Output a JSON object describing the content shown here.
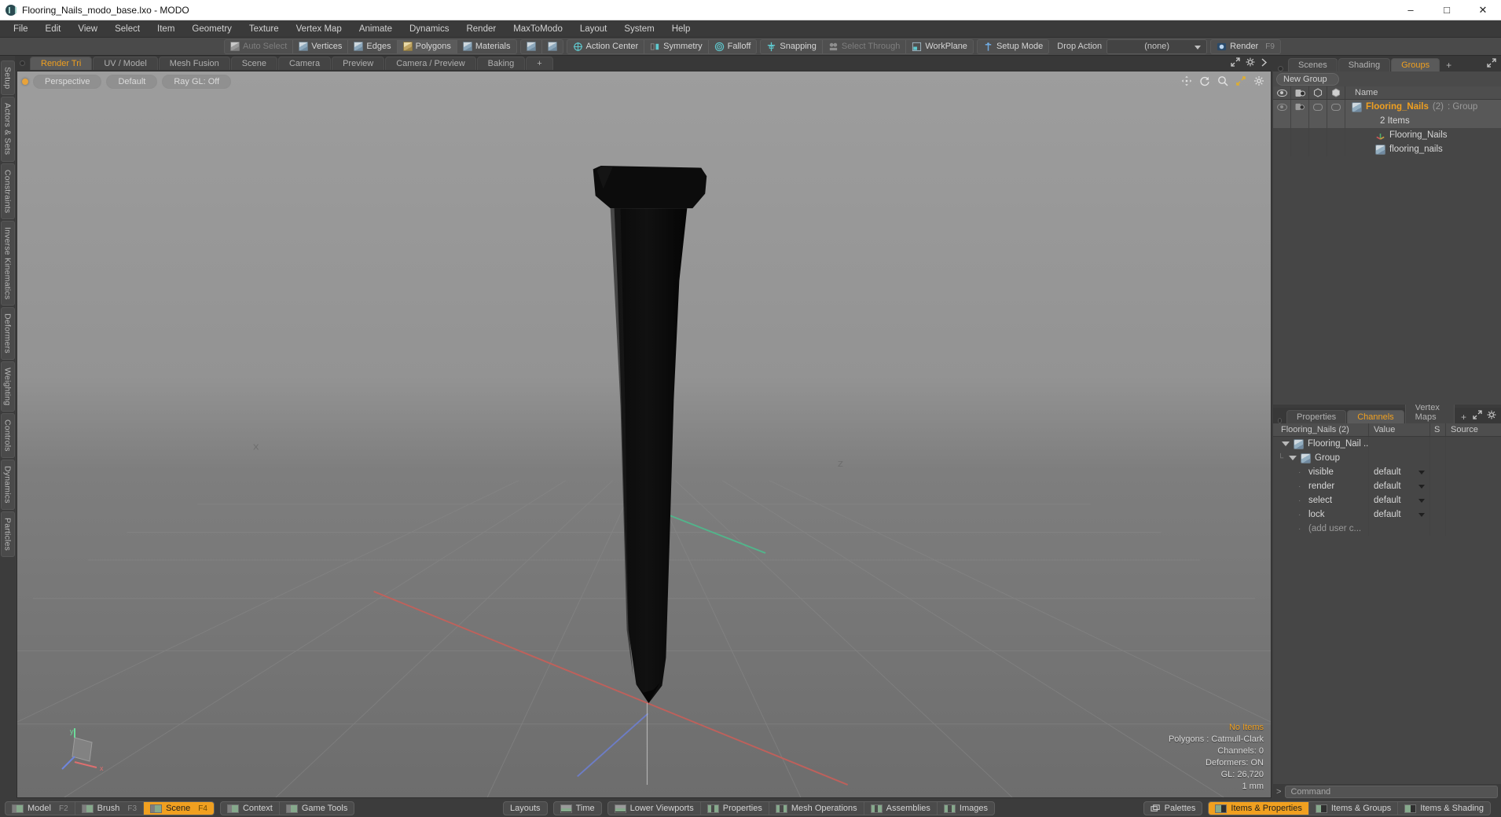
{
  "titlebar": {
    "title": "Flooring_Nails_modo_base.lxo - MODO",
    "minimize": "–",
    "maximize": "□",
    "close": "✕"
  },
  "menubar": {
    "items": [
      "File",
      "Edit",
      "View",
      "Select",
      "Item",
      "Geometry",
      "Texture",
      "Vertex Map",
      "Animate",
      "Dynamics",
      "Render",
      "MaxToModo",
      "Layout",
      "System",
      "Help"
    ]
  },
  "toolbar": {
    "group1": [
      "Auto Select",
      "Vertices",
      "Edges",
      "Polygons",
      "Materials"
    ],
    "group2": [
      "Action Center",
      "Symmetry",
      "Falloff"
    ],
    "group3": [
      "Snapping",
      "Select Through",
      "WorkPlane"
    ],
    "setup_mode": "Setup Mode",
    "drop_action_label": "Drop Action",
    "drop_action_value": "(none)",
    "render": "Render",
    "render_key": "F9"
  },
  "left_sidebar": {
    "items": [
      "Setup",
      "Actors & Sets",
      "Constraints",
      "Inverse Kinematics",
      "Deformers",
      "Weighting",
      "Controls",
      "Dynamics",
      "Particles"
    ]
  },
  "viewport_tabs": {
    "items": [
      "Render Tri",
      "UV / Model",
      "Mesh Fusion",
      "Scene",
      "Camera",
      "Preview",
      "Camera / Preview",
      "Baking"
    ],
    "active": "Render Tri",
    "plus": "+"
  },
  "viewport": {
    "view_mode": "Perspective",
    "shading": "Default",
    "raygl": "Ray GL: Off",
    "axis_x": "x",
    "axis_y": "y",
    "axis_z": "z",
    "stats": {
      "items": "No Items",
      "polygons": "Polygons : Catmull-Clark",
      "channels": "Channels: 0",
      "deformers": "Deformers: ON",
      "gl": "GL: 26,720",
      "unit": "1 mm"
    }
  },
  "right_panel": {
    "tabs": [
      "Scenes",
      "Shading",
      "Groups"
    ],
    "active_tab": "Groups",
    "plus": "+",
    "new_group_button": "New Group",
    "column_name": "Name",
    "tree": [
      {
        "name": "Flooring_Nails",
        "count": "(2)",
        "suffix": ": Group",
        "sub": "2 Items",
        "type": "group",
        "selected": true
      },
      {
        "name": "Flooring_Nails",
        "type": "locator",
        "selected": false
      },
      {
        "name": "flooring_nails",
        "type": "mesh",
        "selected": false
      }
    ]
  },
  "channels_panel": {
    "tabs": [
      "Properties",
      "Channels",
      "Vertex Maps"
    ],
    "active_tab": "Channels",
    "plus": "+",
    "columns": [
      "Flooring_Nails (2)",
      "Value",
      "S",
      "Source"
    ],
    "rows": [
      {
        "name": "Flooring_Nail ...",
        "value": "",
        "depth": 0,
        "type": "item"
      },
      {
        "name": "Group",
        "value": "",
        "depth": 1,
        "type": "item"
      },
      {
        "name": "visible",
        "value": "default",
        "depth": 2,
        "type": "channel"
      },
      {
        "name": "render",
        "value": "default",
        "depth": 2,
        "type": "channel"
      },
      {
        "name": "select",
        "value": "default",
        "depth": 2,
        "type": "channel"
      },
      {
        "name": "lock",
        "value": "default",
        "depth": 2,
        "type": "channel"
      },
      {
        "name": "(add user c...",
        "value": "",
        "depth": 2,
        "type": "adduser"
      }
    ]
  },
  "command_bar": {
    "prompt": ">",
    "placeholder": "Command"
  },
  "bottom_bar": {
    "left_group": [
      {
        "label": "Model",
        "key": "F2",
        "active": false
      },
      {
        "label": "Brush",
        "key": "F3",
        "active": false
      },
      {
        "label": "Scene",
        "key": "F4",
        "active": true
      }
    ],
    "left_group2": [
      {
        "label": "Context"
      },
      {
        "label": "Game Tools"
      }
    ],
    "center_group": [
      {
        "label": "Layouts",
        "icon": false
      },
      {
        "label": "Time",
        "icon": true
      }
    ],
    "center_group2": [
      {
        "label": "Lower Viewports"
      },
      {
        "label": "Properties"
      },
      {
        "label": "Mesh Operations"
      },
      {
        "label": "Assemblies"
      },
      {
        "label": "Images"
      }
    ],
    "right_group": [
      {
        "label": "Palettes",
        "active": false
      },
      {
        "label": "Items & Properties",
        "active": true
      },
      {
        "label": "Items & Groups",
        "active": false
      },
      {
        "label": "Items & Shading",
        "active": false
      }
    ]
  },
  "colors": {
    "accent": "#f0a020",
    "panel": "#3c3c3c",
    "tree_bg": "#464646",
    "toolbar": "#4a4a4a"
  }
}
